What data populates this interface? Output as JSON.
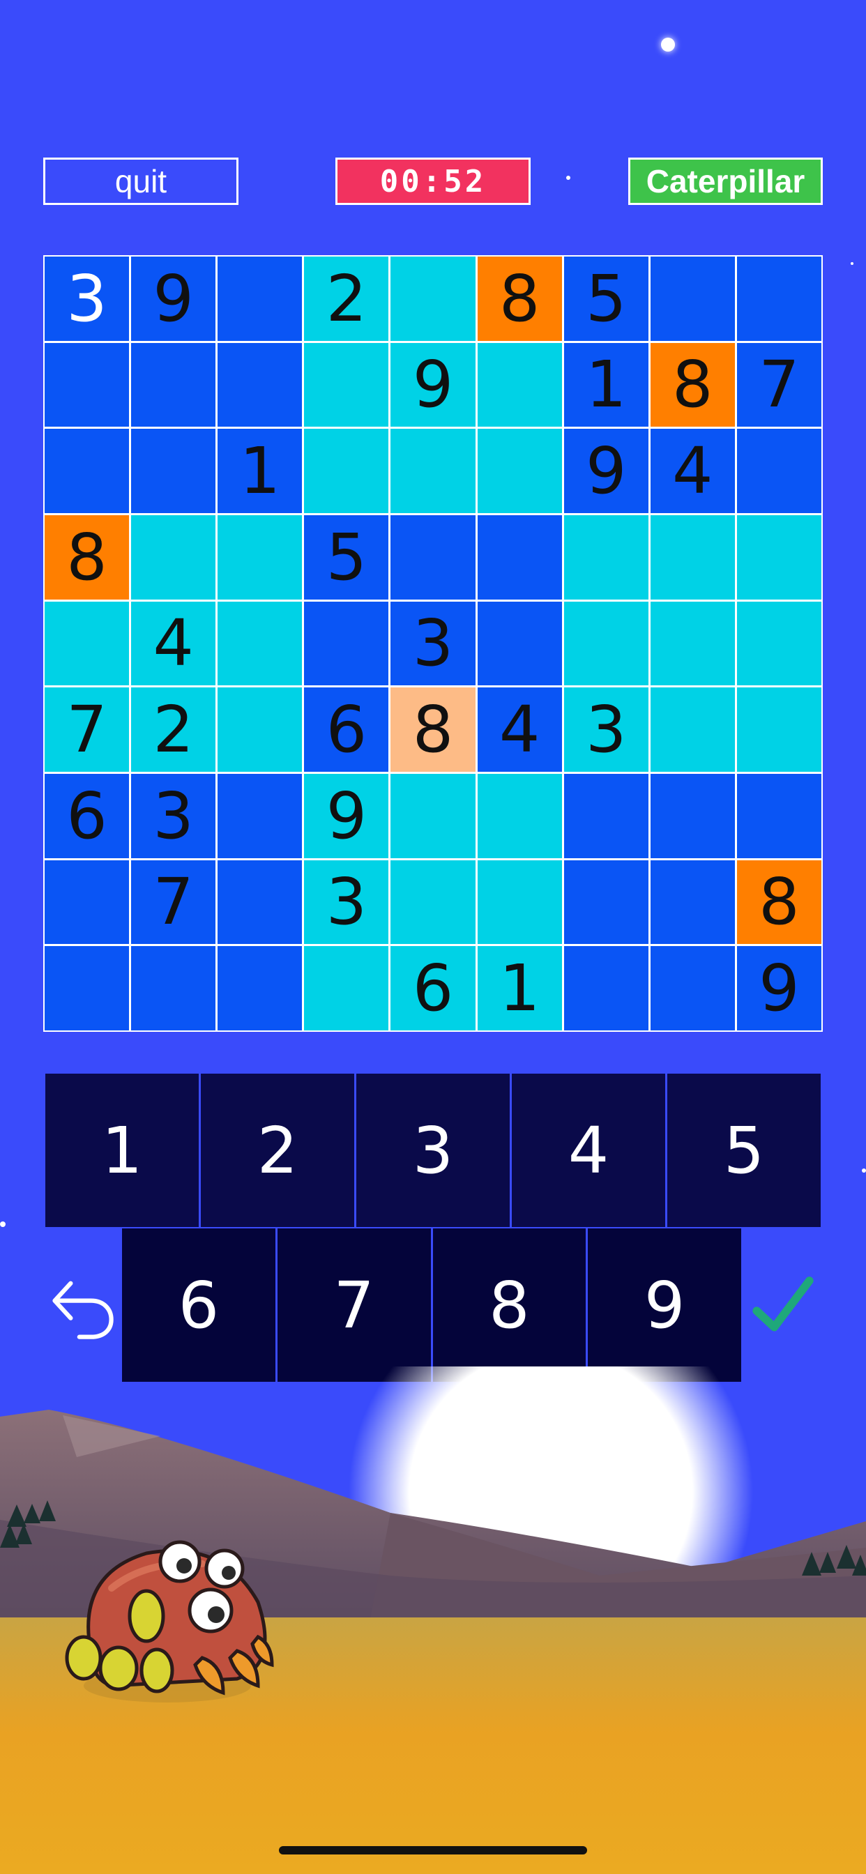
{
  "header": {
    "quit_label": "quit",
    "timer": "00:52",
    "level_name": "Caterpillar"
  },
  "board": {
    "rows": [
      [
        {
          "v": "3",
          "bg": "#0a55f5",
          "w": true
        },
        {
          "v": "9",
          "bg": "#0a55f5"
        },
        {
          "v": "",
          "bg": "#0a55f5"
        },
        {
          "v": "2",
          "bg": "#00d2e6"
        },
        {
          "v": "",
          "bg": "#00d2e6"
        },
        {
          "v": "8",
          "bg": "#ff7f00"
        },
        {
          "v": "5",
          "bg": "#0a55f5"
        },
        {
          "v": "",
          "bg": "#0a55f5"
        },
        {
          "v": "",
          "bg": "#0a55f5"
        }
      ],
      [
        {
          "v": "",
          "bg": "#0a55f5"
        },
        {
          "v": "",
          "bg": "#0a55f5"
        },
        {
          "v": "",
          "bg": "#0a55f5"
        },
        {
          "v": "",
          "bg": "#00d2e6"
        },
        {
          "v": "9",
          "bg": "#00d2e6"
        },
        {
          "v": "",
          "bg": "#00d2e6"
        },
        {
          "v": "1",
          "bg": "#0a55f5"
        },
        {
          "v": "8",
          "bg": "#ff7f00"
        },
        {
          "v": "7",
          "bg": "#0a55f5"
        }
      ],
      [
        {
          "v": "",
          "bg": "#0a55f5"
        },
        {
          "v": "",
          "bg": "#0a55f5"
        },
        {
          "v": "1",
          "bg": "#0a55f5"
        },
        {
          "v": "",
          "bg": "#00d2e6"
        },
        {
          "v": "",
          "bg": "#00d2e6"
        },
        {
          "v": "",
          "bg": "#00d2e6"
        },
        {
          "v": "9",
          "bg": "#0a55f5"
        },
        {
          "v": "4",
          "bg": "#0a55f5"
        },
        {
          "v": "",
          "bg": "#0a55f5"
        }
      ],
      [
        {
          "v": "8",
          "bg": "#ff7f00"
        },
        {
          "v": "",
          "bg": "#00d2e6"
        },
        {
          "v": "",
          "bg": "#00d2e6"
        },
        {
          "v": "5",
          "bg": "#0a55f5"
        },
        {
          "v": "",
          "bg": "#0a55f5"
        },
        {
          "v": "",
          "bg": "#0a55f5"
        },
        {
          "v": "",
          "bg": "#00d2e6"
        },
        {
          "v": "",
          "bg": "#00d2e6"
        },
        {
          "v": "",
          "bg": "#00d2e6"
        }
      ],
      [
        {
          "v": "",
          "bg": "#00d2e6"
        },
        {
          "v": "4",
          "bg": "#00d2e6"
        },
        {
          "v": "",
          "bg": "#00d2e6"
        },
        {
          "v": "",
          "bg": "#0a55f5"
        },
        {
          "v": "3",
          "bg": "#0a55f5"
        },
        {
          "v": "",
          "bg": "#0a55f5"
        },
        {
          "v": "",
          "bg": "#00d2e6"
        },
        {
          "v": "",
          "bg": "#00d2e6"
        },
        {
          "v": "",
          "bg": "#00d2e6"
        }
      ],
      [
        {
          "v": "7",
          "bg": "#00d2e6"
        },
        {
          "v": "2",
          "bg": "#00d2e6"
        },
        {
          "v": "",
          "bg": "#00d2e6"
        },
        {
          "v": "6",
          "bg": "#0a55f5"
        },
        {
          "v": "8",
          "bg": "#fdbb86"
        },
        {
          "v": "4",
          "bg": "#0a55f5"
        },
        {
          "v": "3",
          "bg": "#00d2e6"
        },
        {
          "v": "",
          "bg": "#00d2e6"
        },
        {
          "v": "",
          "bg": "#00d2e6"
        }
      ],
      [
        {
          "v": "6",
          "bg": "#0a55f5"
        },
        {
          "v": "3",
          "bg": "#0a55f5"
        },
        {
          "v": "",
          "bg": "#0a55f5"
        },
        {
          "v": "9",
          "bg": "#00d2e6"
        },
        {
          "v": "",
          "bg": "#00d2e6"
        },
        {
          "v": "",
          "bg": "#00d2e6"
        },
        {
          "v": "",
          "bg": "#0a55f5"
        },
        {
          "v": "",
          "bg": "#0a55f5"
        },
        {
          "v": "",
          "bg": "#0a55f5"
        }
      ],
      [
        {
          "v": "",
          "bg": "#0a55f5"
        },
        {
          "v": "7",
          "bg": "#0a55f5"
        },
        {
          "v": "",
          "bg": "#0a55f5"
        },
        {
          "v": "3",
          "bg": "#00d2e6"
        },
        {
          "v": "",
          "bg": "#00d2e6"
        },
        {
          "v": "",
          "bg": "#00d2e6"
        },
        {
          "v": "",
          "bg": "#0a55f5"
        },
        {
          "v": "",
          "bg": "#0a55f5"
        },
        {
          "v": "8",
          "bg": "#ff7f00"
        }
      ],
      [
        {
          "v": "",
          "bg": "#0a55f5"
        },
        {
          "v": "",
          "bg": "#0a55f5"
        },
        {
          "v": "",
          "bg": "#0a55f5"
        },
        {
          "v": "",
          "bg": "#00d2e6"
        },
        {
          "v": "6",
          "bg": "#00d2e6"
        },
        {
          "v": "1",
          "bg": "#00d2e6"
        },
        {
          "v": "",
          "bg": "#0a55f5"
        },
        {
          "v": "",
          "bg": "#0a55f5"
        },
        {
          "v": "9",
          "bg": "#0a55f5"
        }
      ]
    ]
  },
  "keypad": {
    "row1": [
      "1",
      "2",
      "3",
      "4",
      "5"
    ],
    "row2": [
      "6",
      "7",
      "8",
      "9"
    ]
  },
  "icons": {
    "undo": "undo-arrow-icon",
    "confirm": "checkmark-icon"
  },
  "colors": {
    "background": "#3a4bfb",
    "timer": "#f2325f",
    "level": "#3ec34a",
    "check": "#1fa87a"
  }
}
